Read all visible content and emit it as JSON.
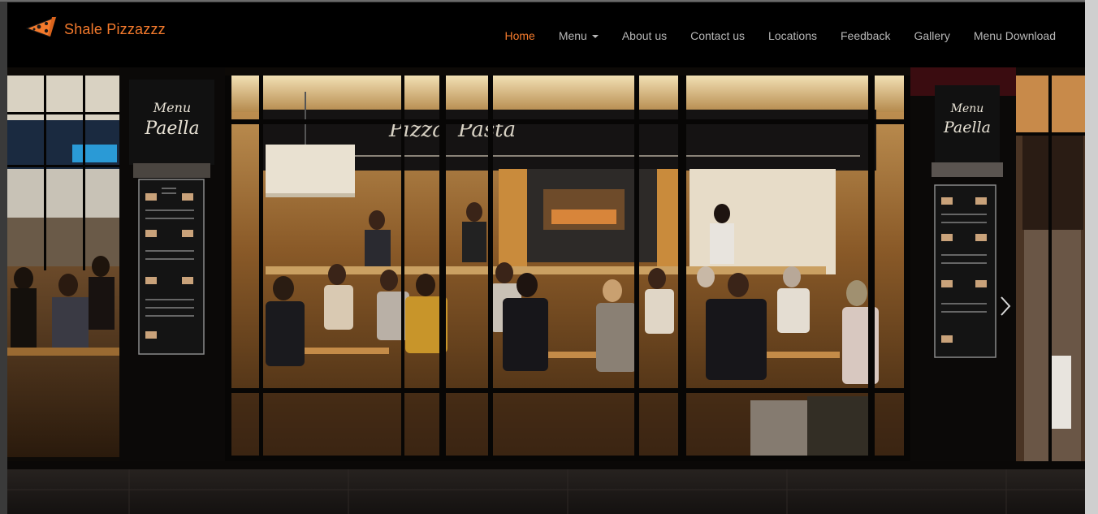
{
  "brand": {
    "name": "Shale Pizzazzz",
    "logo_icon": "pizza-slice-icon",
    "accent_color": "#f47a2c"
  },
  "nav": {
    "items": [
      {
        "label": "Home",
        "active": true
      },
      {
        "label": "Menu",
        "dropdown": true
      },
      {
        "label": "About us"
      },
      {
        "label": "Contact us"
      },
      {
        "label": "Locations"
      },
      {
        "label": "Feedback"
      },
      {
        "label": "Gallery"
      },
      {
        "label": "Menu Download"
      }
    ]
  },
  "hero": {
    "image_subject": "restaurant-storefront-at-night",
    "next_icon": "chevron-right-icon"
  }
}
